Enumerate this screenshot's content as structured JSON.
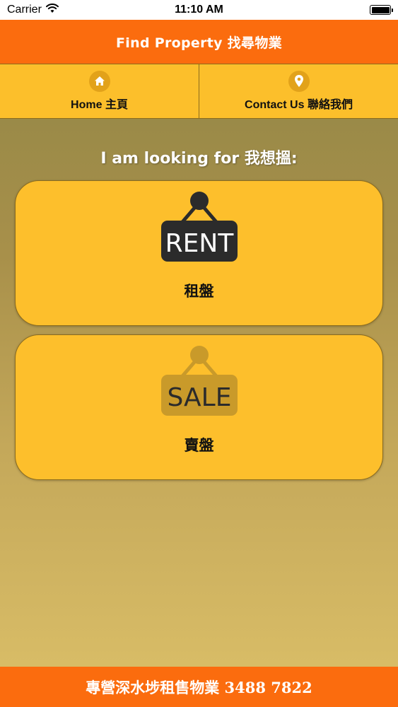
{
  "status_bar": {
    "carrier": "Carrier",
    "time": "11:10 AM",
    "icons": {
      "wifi": "wifi-icon",
      "battery": "battery-icon"
    },
    "battery_level": 1.0
  },
  "header": {
    "title": "Find Property 找尋物業",
    "color": "#fb6c0e"
  },
  "nav": {
    "items": [
      {
        "label": "Home 主頁",
        "icon": "home-icon"
      },
      {
        "label": "Contact Us 聯絡我們",
        "icon": "location-pin-icon"
      }
    ],
    "color": "#fcbf2b"
  },
  "main": {
    "prompt": "I am looking for 我想搵:",
    "options": [
      {
        "sign_text": "RENT",
        "label": "租盤",
        "icon": "rent-sign-icon",
        "sign_color": "#2b2b2b"
      },
      {
        "sign_text": "SALE",
        "label": "賣盤",
        "icon": "sale-sign-icon",
        "sign_color": "#c99a2a"
      }
    ]
  },
  "footer": {
    "text": "專營深水埗租售物業 3488 7822",
    "color": "#fb6c0e"
  }
}
